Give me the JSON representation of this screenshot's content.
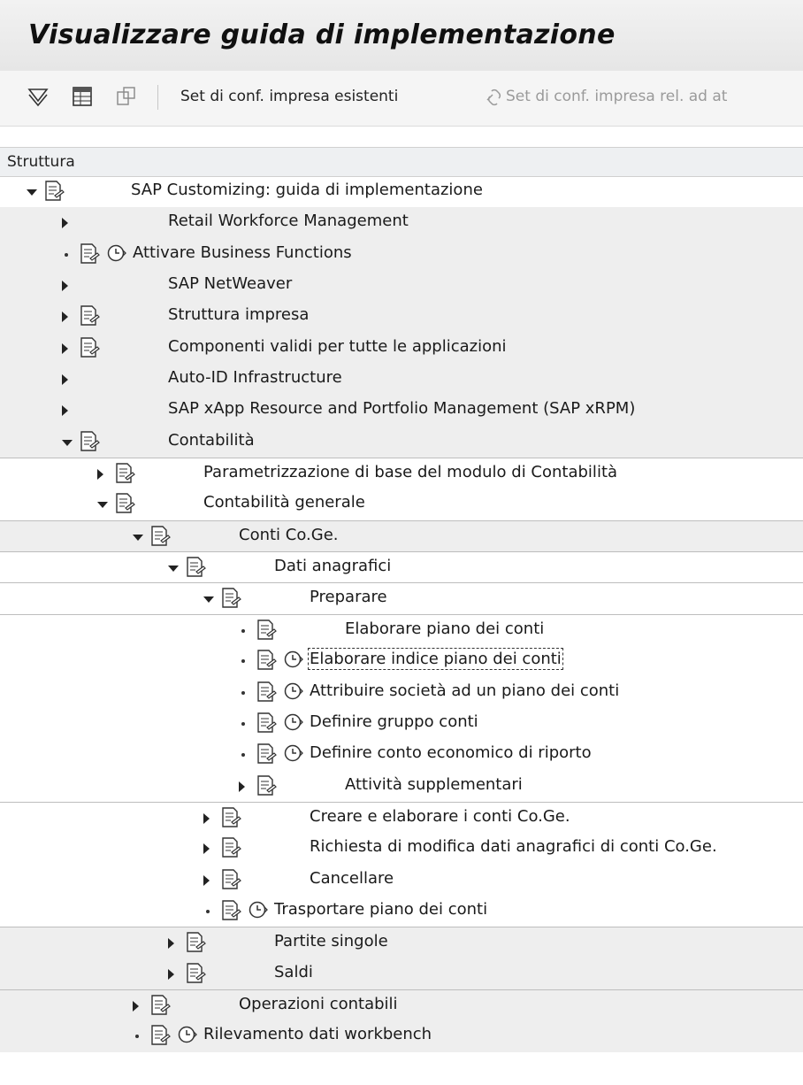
{
  "window": {
    "title": "Visualizzare guida di implementazione"
  },
  "toolbar": {
    "icons": [
      "filter-icon",
      "table-icon",
      "copy-icon"
    ],
    "existing_sets": "Set di conf. impresa esistenti",
    "related_sets": "Set di conf. impresa rel. ad at"
  },
  "tree": {
    "header": "Struttura",
    "nodes": [
      {
        "level": 0,
        "toggle": "expanded",
        "doc": true,
        "clock": false,
        "label": "SAP Customizing: guida di implementazione",
        "shade": false
      },
      {
        "level": 1,
        "toggle": "collapsed",
        "doc": false,
        "clock": false,
        "label": "Retail Workforce Management",
        "shade": true
      },
      {
        "level": 1,
        "toggle": "leaf",
        "doc": true,
        "clock": true,
        "label": "Attivare Business Functions",
        "shade": true
      },
      {
        "level": 1,
        "toggle": "collapsed",
        "doc": false,
        "clock": false,
        "label": "SAP NetWeaver",
        "shade": true
      },
      {
        "level": 1,
        "toggle": "collapsed",
        "doc": true,
        "clock": false,
        "label": "Struttura impresa",
        "shade": true
      },
      {
        "level": 1,
        "toggle": "collapsed",
        "doc": true,
        "clock": false,
        "label": "Componenti validi per tutte le applicazioni",
        "shade": true
      },
      {
        "level": 1,
        "toggle": "collapsed",
        "doc": false,
        "clock": false,
        "label": "Auto-ID Infrastructure",
        "shade": true
      },
      {
        "level": 1,
        "toggle": "collapsed",
        "doc": false,
        "clock": false,
        "label": "SAP xApp Resource and Portfolio Management (SAP xRPM)",
        "shade": true
      },
      {
        "level": 1,
        "toggle": "expanded",
        "doc": true,
        "clock": false,
        "label": "Contabilità",
        "shade": true
      },
      {
        "level": 2,
        "toggle": "collapsed",
        "doc": true,
        "clock": false,
        "label": "Parametrizzazione di base del modulo di Contabilità",
        "shade": false,
        "topline": true
      },
      {
        "level": 2,
        "toggle": "expanded",
        "doc": true,
        "clock": false,
        "label": "Contabilità generale",
        "shade": false
      },
      {
        "level": 3,
        "toggle": "expanded",
        "doc": true,
        "clock": false,
        "label": "Conti Co.Ge.",
        "shade": true,
        "topline": true
      },
      {
        "level": 4,
        "toggle": "expanded",
        "doc": true,
        "clock": false,
        "label": "Dati anagrafici",
        "shade": false,
        "topline": true
      },
      {
        "level": 5,
        "toggle": "expanded",
        "doc": true,
        "clock": false,
        "label": "Preparare",
        "shade": false,
        "topline": true
      },
      {
        "level": 6,
        "toggle": "leaf",
        "doc": true,
        "clock": false,
        "label": "Elaborare piano dei conti",
        "shade": false,
        "topline": true
      },
      {
        "level": 6,
        "toggle": "leaf",
        "doc": true,
        "clock": true,
        "label": "Elaborare indice piano dei conti",
        "shade": false,
        "focus": true
      },
      {
        "level": 6,
        "toggle": "leaf",
        "doc": true,
        "clock": true,
        "label": "Attribuire società ad un piano dei conti",
        "shade": false
      },
      {
        "level": 6,
        "toggle": "leaf",
        "doc": true,
        "clock": true,
        "label": "Definire gruppo conti",
        "shade": false
      },
      {
        "level": 6,
        "toggle": "leaf",
        "doc": true,
        "clock": true,
        "label": "Definire conto economico di riporto",
        "shade": false
      },
      {
        "level": 6,
        "toggle": "collapsed",
        "doc": true,
        "clock": false,
        "label": "Attività supplementari",
        "shade": false
      },
      {
        "level": 5,
        "toggle": "collapsed",
        "doc": true,
        "clock": false,
        "label": "Creare e elaborare i conti Co.Ge.",
        "shade": false,
        "topline": true
      },
      {
        "level": 5,
        "toggle": "collapsed",
        "doc": true,
        "clock": false,
        "label": "Richiesta di modifica dati anagrafici di conti Co.Ge.",
        "shade": false
      },
      {
        "level": 5,
        "toggle": "collapsed",
        "doc": true,
        "clock": false,
        "label": "Cancellare",
        "shade": false
      },
      {
        "level": 5,
        "toggle": "leaf",
        "doc": true,
        "clock": true,
        "label": "Trasportare piano dei conti",
        "shade": false
      },
      {
        "level": 4,
        "toggle": "collapsed",
        "doc": true,
        "clock": false,
        "label": "Partite singole",
        "shade": true,
        "topline": true
      },
      {
        "level": 4,
        "toggle": "collapsed",
        "doc": true,
        "clock": false,
        "label": "Saldi",
        "shade": true
      },
      {
        "level": 3,
        "toggle": "collapsed",
        "doc": true,
        "clock": false,
        "label": "Operazioni contabili",
        "shade": true,
        "topline": true
      },
      {
        "level": 3,
        "toggle": "leaf",
        "doc": true,
        "clock": true,
        "label": "Rilevamento dati workbench",
        "shade": true
      }
    ]
  }
}
